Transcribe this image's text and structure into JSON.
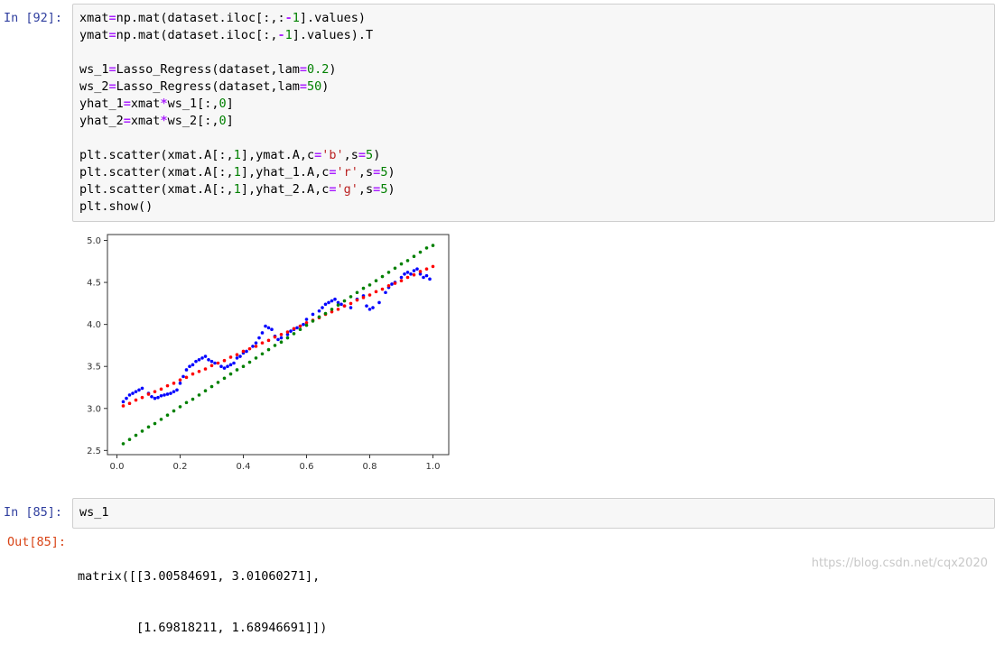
{
  "cells": [
    {
      "prompt": "In  [92]:",
      "code": [
        "xmat=np.mat(dataset.iloc[:,:-1].values)",
        "ymat=np.mat(dataset.iloc[:,-1].values).T",
        "",
        "ws_1=Lasso_Regress(dataset,lam=0.2)",
        "ws_2=Lasso_Regress(dataset,lam=50)",
        "yhat_1=xmat*ws_1[:,0]",
        "yhat_2=xmat*ws_2[:,0]",
        "",
        "plt.scatter(xmat.A[:,1],ymat.A,c='b',s=5)",
        "plt.scatter(xmat.A[:,1],yhat_1.A,c='r',s=5)",
        "plt.scatter(xmat.A[:,1],yhat_2.A,c='g',s=5)",
        "plt.show()"
      ]
    },
    {
      "prompt": "In  [85]:",
      "code": [
        "ws_1"
      ],
      "out_prompt": "Out[85]:",
      "output": [
        "matrix([[3.00584691, 3.01060271],",
        "        [1.69818211, 1.68946691]])"
      ]
    }
  ],
  "watermark": "https://blog.csdn.net/cqx2020",
  "chart_data": {
    "type": "scatter",
    "xlim": [
      -0.03,
      1.05
    ],
    "ylim": [
      2.45,
      5.07
    ],
    "xticks": [
      "0.0",
      "0.2",
      "0.4",
      "0.6",
      "0.8",
      "1.0"
    ],
    "yticks": [
      "2.5",
      "3.0",
      "3.5",
      "4.0",
      "4.5",
      "5.0"
    ],
    "series": [
      {
        "color": "#0000ff",
        "kind": "data",
        "x": [
          0.02,
          0.03,
          0.04,
          0.05,
          0.06,
          0.07,
          0.08,
          0.1,
          0.11,
          0.12,
          0.13,
          0.14,
          0.15,
          0.16,
          0.17,
          0.18,
          0.19,
          0.2,
          0.21,
          0.22,
          0.23,
          0.24,
          0.25,
          0.26,
          0.27,
          0.28,
          0.29,
          0.3,
          0.31,
          0.33,
          0.34,
          0.35,
          0.36,
          0.37,
          0.38,
          0.39,
          0.4,
          0.41,
          0.43,
          0.44,
          0.45,
          0.46,
          0.47,
          0.48,
          0.49,
          0.5,
          0.51,
          0.52,
          0.54,
          0.55,
          0.56,
          0.57,
          0.58,
          0.59,
          0.6,
          0.62,
          0.64,
          0.65,
          0.66,
          0.67,
          0.68,
          0.69,
          0.7,
          0.71,
          0.72,
          0.74,
          0.76,
          0.78,
          0.79,
          0.8,
          0.81,
          0.83,
          0.85,
          0.86,
          0.87,
          0.88,
          0.9,
          0.91,
          0.92,
          0.93,
          0.94,
          0.95,
          0.96,
          0.97,
          0.98,
          0.99
        ],
        "y": [
          3.08,
          3.12,
          3.16,
          3.18,
          3.2,
          3.22,
          3.24,
          3.18,
          3.14,
          3.12,
          3.13,
          3.15,
          3.16,
          3.17,
          3.18,
          3.2,
          3.22,
          3.3,
          3.38,
          3.46,
          3.5,
          3.52,
          3.56,
          3.58,
          3.6,
          3.62,
          3.58,
          3.56,
          3.54,
          3.5,
          3.48,
          3.5,
          3.52,
          3.54,
          3.6,
          3.62,
          3.66,
          3.68,
          3.74,
          3.78,
          3.84,
          3.9,
          3.98,
          3.96,
          3.94,
          3.86,
          3.82,
          3.84,
          3.88,
          3.92,
          3.94,
          3.96,
          3.98,
          4.0,
          4.06,
          4.12,
          4.16,
          4.2,
          4.24,
          4.26,
          4.28,
          4.3,
          4.26,
          4.24,
          4.22,
          4.2,
          4.3,
          4.34,
          4.22,
          4.18,
          4.2,
          4.26,
          4.38,
          4.44,
          4.48,
          4.5,
          4.56,
          4.6,
          4.62,
          4.6,
          4.64,
          4.66,
          4.6,
          4.56,
          4.58,
          4.54
        ]
      },
      {
        "color": "#ff0000",
        "kind": "fit_lam_0.2",
        "x": [
          0.02,
          0.04,
          0.06,
          0.08,
          0.1,
          0.12,
          0.14,
          0.16,
          0.18,
          0.2,
          0.22,
          0.24,
          0.26,
          0.28,
          0.3,
          0.32,
          0.34,
          0.36,
          0.38,
          0.4,
          0.42,
          0.44,
          0.46,
          0.48,
          0.5,
          0.52,
          0.54,
          0.56,
          0.58,
          0.6,
          0.62,
          0.64,
          0.66,
          0.68,
          0.7,
          0.72,
          0.74,
          0.76,
          0.78,
          0.8,
          0.82,
          0.84,
          0.86,
          0.88,
          0.9,
          0.92,
          0.94,
          0.96,
          0.98,
          1.0
        ],
        "y": [
          3.03,
          3.06,
          3.1,
          3.13,
          3.17,
          3.2,
          3.23,
          3.27,
          3.3,
          3.34,
          3.37,
          3.41,
          3.44,
          3.47,
          3.51,
          3.54,
          3.57,
          3.61,
          3.64,
          3.68,
          3.71,
          3.74,
          3.78,
          3.81,
          3.85,
          3.88,
          3.91,
          3.95,
          3.98,
          4.02,
          4.05,
          4.08,
          4.12,
          4.15,
          4.18,
          4.22,
          4.25,
          4.29,
          4.32,
          4.35,
          4.39,
          4.42,
          4.46,
          4.49,
          4.52,
          4.56,
          4.59,
          4.63,
          4.66,
          4.69
        ]
      },
      {
        "color": "#008000",
        "kind": "fit_lam_50",
        "x": [
          0.02,
          0.04,
          0.06,
          0.08,
          0.1,
          0.12,
          0.14,
          0.16,
          0.18,
          0.2,
          0.22,
          0.24,
          0.26,
          0.28,
          0.3,
          0.32,
          0.34,
          0.36,
          0.38,
          0.4,
          0.42,
          0.44,
          0.46,
          0.48,
          0.5,
          0.52,
          0.54,
          0.56,
          0.58,
          0.6,
          0.62,
          0.64,
          0.66,
          0.68,
          0.7,
          0.72,
          0.74,
          0.76,
          0.78,
          0.8,
          0.82,
          0.84,
          0.86,
          0.88,
          0.9,
          0.92,
          0.94,
          0.96,
          0.98,
          1.0
        ],
        "y": [
          2.58,
          2.63,
          2.68,
          2.73,
          2.78,
          2.82,
          2.87,
          2.92,
          2.97,
          3.02,
          3.07,
          3.11,
          3.16,
          3.21,
          3.26,
          3.31,
          3.36,
          3.41,
          3.46,
          3.5,
          3.55,
          3.6,
          3.65,
          3.7,
          3.75,
          3.79,
          3.84,
          3.89,
          3.94,
          3.99,
          4.04,
          4.09,
          4.13,
          4.18,
          4.23,
          4.28,
          4.33,
          4.38,
          4.43,
          4.47,
          4.52,
          4.57,
          4.62,
          4.67,
          4.72,
          4.76,
          4.81,
          4.86,
          4.91,
          4.94
        ]
      }
    ]
  }
}
